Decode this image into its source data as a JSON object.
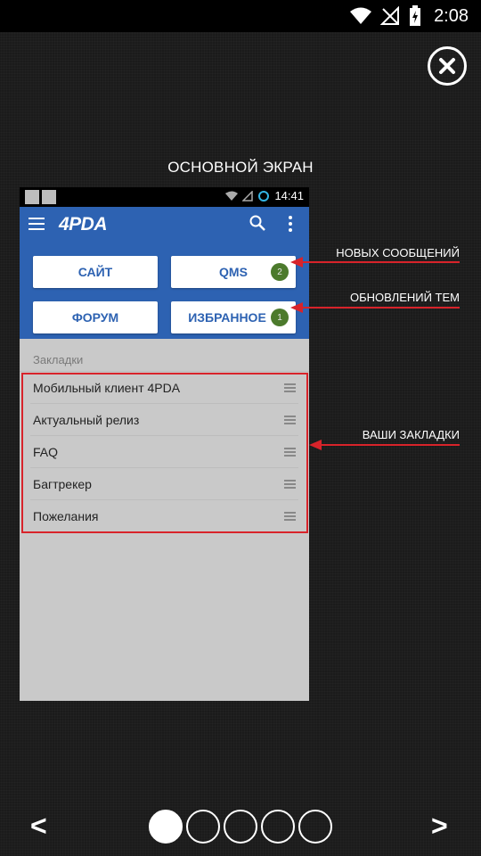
{
  "statusbar": {
    "time": "2:08"
  },
  "overlay": {
    "title": "ОСНОВНОЙ ЭКРАН",
    "close_icon": "close-icon"
  },
  "preview": {
    "status_time": "14:41",
    "logo": "4PDA",
    "buttons": {
      "site": "САЙТ",
      "qms": "QMS",
      "qms_badge": "2",
      "forum": "ФОРУМ",
      "favorites": "ИЗБРАННОЕ",
      "favorites_badge": "1"
    },
    "section_label": "Закладки",
    "bookmarks": [
      "Мобильный клиент 4PDA",
      "Актуальный релиз",
      "FAQ",
      "Багтрекер",
      "Пожелания"
    ],
    "accent_color": "#2d62b2",
    "badge_color": "#4c7a2c"
  },
  "annotations": {
    "new_messages": "НОВЫХ СООБЩЕНИЙ",
    "topic_updates": "ОБНОВЛЕНИЙ ТЕМ",
    "your_bookmarks": "ВАШИ ЗАКЛАДКИ",
    "arrow_color": "#d8232a"
  },
  "navigation": {
    "prev": "<",
    "next": ">",
    "pages_total": 5,
    "active_page": 1
  }
}
